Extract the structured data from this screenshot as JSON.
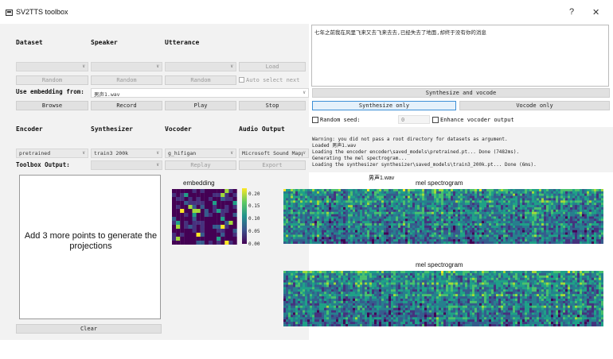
{
  "window": {
    "title": "SV2TTS toolbox",
    "help": "?",
    "close": "✕"
  },
  "left": {
    "headers": {
      "dataset": "Dataset",
      "speaker": "Speaker",
      "utterance": "Utterance"
    },
    "buttons_row1": {
      "load": "Load",
      "random1": "Random",
      "random2": "Random",
      "random3": "Random",
      "auto_select": "Auto select next"
    },
    "use_embedding": {
      "label": "Use embedding from:",
      "value": "男声1.wav"
    },
    "buttons_row2": {
      "browse": "Browse",
      "record": "Record",
      "play": "Play",
      "stop": "Stop"
    },
    "model_headers": {
      "encoder": "Encoder",
      "synthesizer": "Synthesizer",
      "vocoder": "Vocoder",
      "audio_output": "Audio Output"
    },
    "models": {
      "encoder": "pretrained",
      "synthesizer": "train3 200k",
      "vocoder": "g_hifigan",
      "audio_output": "Microsoft Sound Mapp"
    },
    "toolbox_output": {
      "label": "Toolbox Output:",
      "replay": "Replay",
      "export": "Export"
    },
    "projections_text": "Add 3 more points to generate the projections",
    "clear": "Clear",
    "embedding_title": "embedding",
    "colorbar_ticks": [
      "0.20",
      "0.15",
      "0.10",
      "0.05",
      "0.00"
    ]
  },
  "right": {
    "text_input": "七年之前我在风里飞来又去飞来去去,已经失去了地面,却终于没有你的消息",
    "synth_vocode": "Synthesize and vocode",
    "synth_only": "Synthesize only",
    "vocode_only": "Vocode only",
    "random_seed_label": "Random seed:",
    "random_seed_value": "0",
    "enhance_label": "Enhance vocoder output",
    "log": [
      "Warning: you did not pass a root directory for datasets as argument.",
      "Loaded 男声1.wav",
      "Loading the encoder encoder\\saved_models\\pretrained.pt... Done (7482ms).",
      "Generating the mel spectrogram...",
      "Loading the synthesizer synthesizer\\saved_models\\train3_200k.pt... Done (6ms)."
    ],
    "spec1_caption": "男声1.wav",
    "spec1_title": "mel spectrogram",
    "spec2_title": "mel spectrogram"
  }
}
